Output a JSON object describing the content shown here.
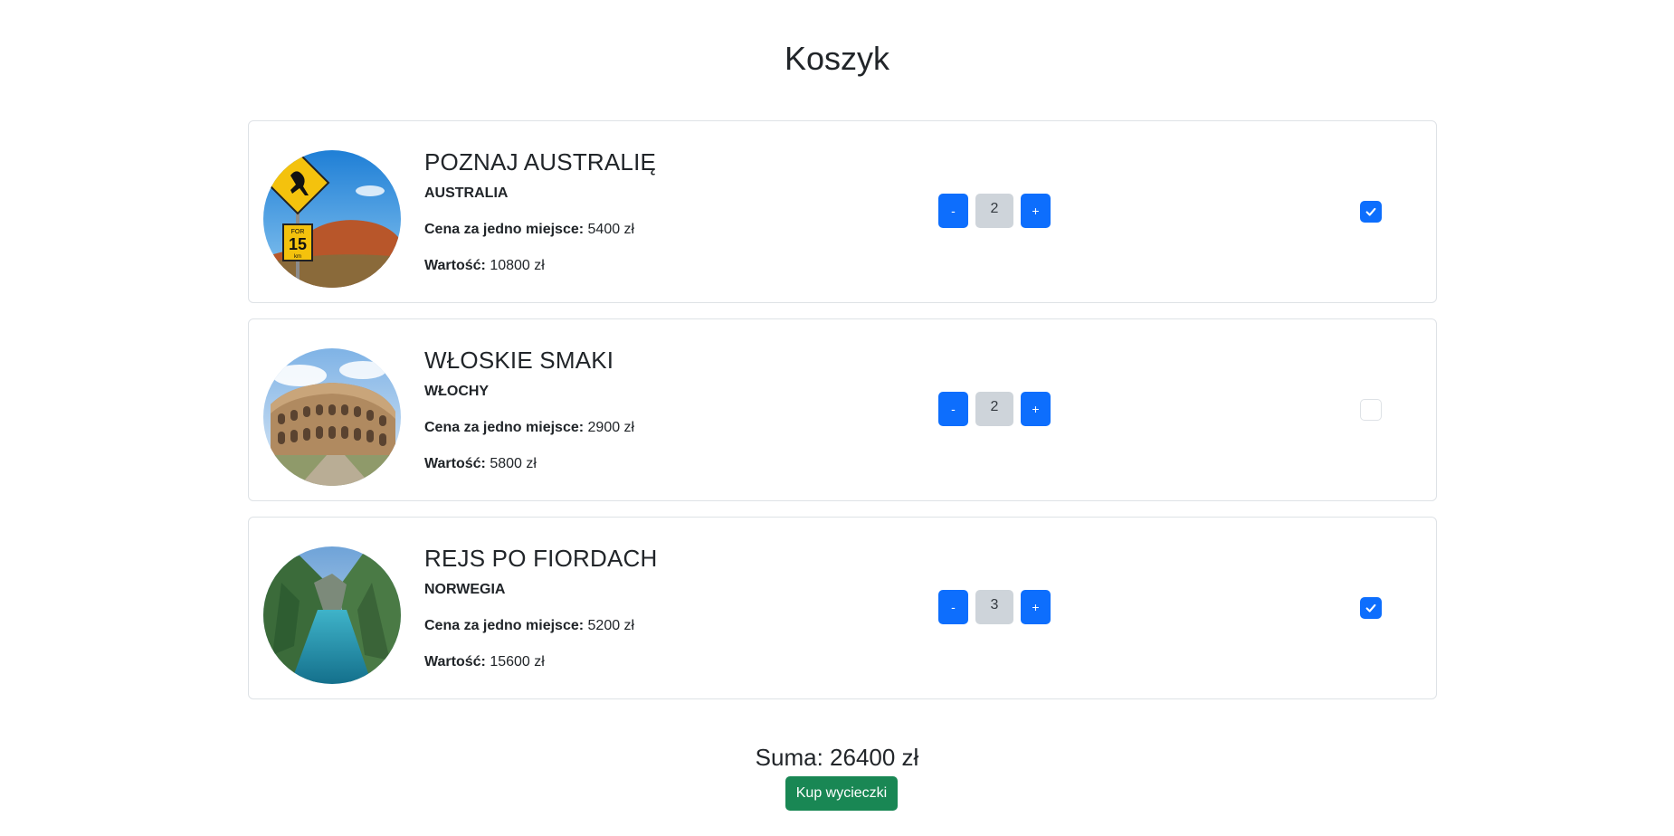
{
  "page": {
    "title": "Koszyk"
  },
  "labels": {
    "price_label": "Cena za jedno miejsce:",
    "value_label": "Wartość:",
    "minus": "-",
    "plus": "+"
  },
  "items": [
    {
      "name": "POZNAJ AUSTRALIĘ",
      "country": "AUSTRALIA",
      "price": "5400 zł",
      "value": "10800 zł",
      "quantity": "2",
      "checked": true,
      "image_icon": "australia-kangaroo-sign-photo"
    },
    {
      "name": "WŁOSKIE SMAKI",
      "country": "WŁOCHY",
      "price": "2900 zł",
      "value": "5800 zł",
      "quantity": "2",
      "checked": false,
      "image_icon": "colosseum-photo"
    },
    {
      "name": "REJS PO FIORDACH",
      "country": "NORWEGIA",
      "price": "5200 zł",
      "value": "15600 zł",
      "quantity": "3",
      "checked": true,
      "image_icon": "fjord-photo"
    }
  ],
  "summary": {
    "text": "Suma: 26400 zł"
  },
  "buy_button": {
    "label": "Kup wycieczki"
  },
  "colors": {
    "primary": "#0d6efd",
    "success": "#198754",
    "qty_bg": "#ced4da",
    "border": "#dee2e6"
  }
}
